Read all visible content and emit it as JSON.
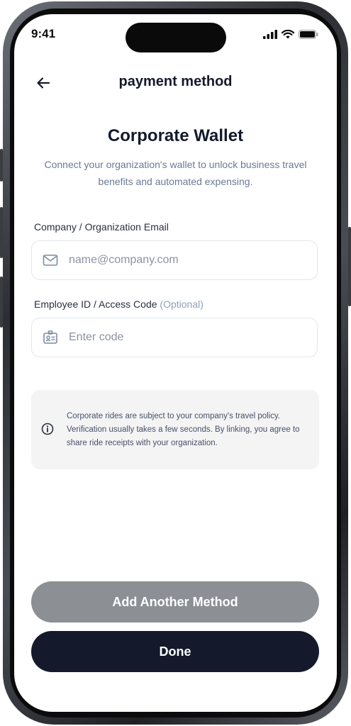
{
  "status_bar": {
    "time": "9:41"
  },
  "header": {
    "title": "payment method"
  },
  "hero": {
    "title": "Corporate Wallet",
    "subtitle": "Connect your organization's wallet to unlock business travel benefits and automated expensing."
  },
  "email_field": {
    "label": "Company / Organization Email",
    "placeholder": "name@company.com",
    "icon": "mail-icon"
  },
  "code_field": {
    "label": "Employee ID / Access Code",
    "label_optional": "(Optional)",
    "placeholder": "Enter code",
    "icon": "id-badge-icon"
  },
  "notice": {
    "icon": "info-icon",
    "text": "Corporate rides are subject to your company's travel policy. Verification usually takes a few seconds. By linking, you agree to share ride receipts with your organization."
  },
  "buttons": {
    "add_another": "Add Another Method",
    "done": "Done"
  },
  "colors": {
    "primary": "#141a2b",
    "secondary_button": "#8c8f94",
    "muted_text": "#6b7a95"
  }
}
